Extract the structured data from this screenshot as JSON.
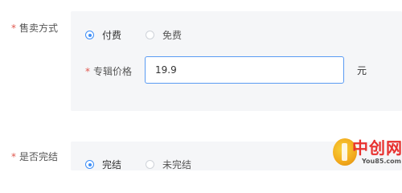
{
  "sale_mode": {
    "label": "售卖方式",
    "options": [
      {
        "label": "付费",
        "selected": true
      },
      {
        "label": "免费",
        "selected": false
      }
    ]
  },
  "album_price": {
    "label": "专辑价格",
    "value": "19.9",
    "unit": "元"
  },
  "completion": {
    "label": "是否完结",
    "options": [
      {
        "label": "完结",
        "selected": true
      },
      {
        "label": "未完结",
        "selected": false
      }
    ]
  },
  "watermark": {
    "title": "中创网",
    "subtitle": "You85.com"
  },
  "colors": {
    "accent": "#3e8ef7",
    "required": "#e0584f",
    "panel_bg": "#f5f6f8"
  }
}
